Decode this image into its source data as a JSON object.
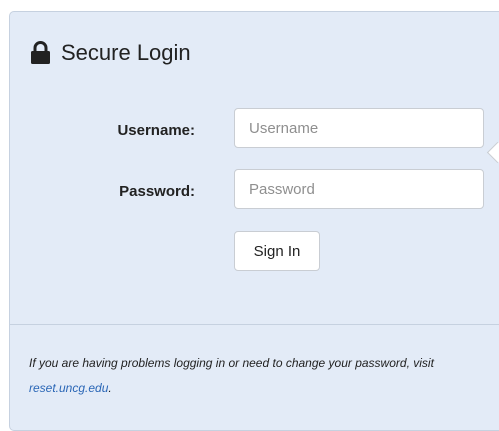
{
  "login": {
    "title": "Secure Login",
    "username_label": "Username:",
    "username_placeholder": "Username",
    "password_label": "Password:",
    "password_placeholder": "Password",
    "signin_label": "Sign In"
  },
  "help": {
    "text": "If you are having problems logging in or need to change your password, visit ",
    "link_text": "reset.uncg.edu",
    "suffix": "."
  },
  "icons": {
    "lock": "lock-icon"
  },
  "colors": {
    "panel_bg": "#e3ebf7",
    "panel_border": "#c6d1e0",
    "link": "#2a66b6"
  }
}
